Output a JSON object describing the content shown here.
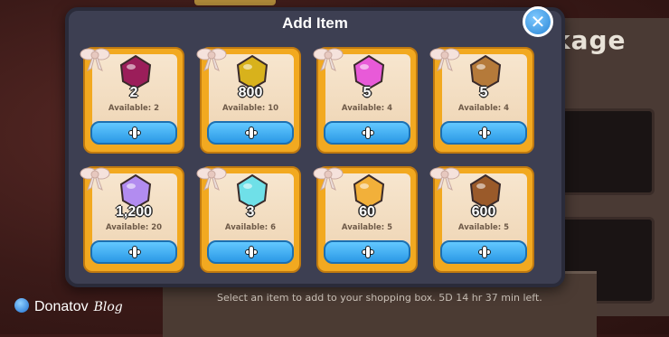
{
  "background": {
    "partial_title": "kage",
    "info_text": "Select an item to add to your shopping box. 5D 14 hr 37 min left."
  },
  "modal": {
    "title": "Add Item",
    "close_label": "✕"
  },
  "items": [
    {
      "qty": "2",
      "available": "Available: 2",
      "icon": "dark-crystal-icon",
      "color": "#9b1e5a"
    },
    {
      "qty": "800",
      "available": "Available: 10",
      "icon": "gold-clock-icon",
      "color": "#d8b21c"
    },
    {
      "qty": "5",
      "available": "Available: 4",
      "icon": "pink-cookie-cutter-icon",
      "color": "#e85ad8"
    },
    {
      "qty": "5",
      "available": "Available: 4",
      "icon": "bronze-medallion-icon",
      "color": "#b57a3a"
    },
    {
      "qty": "1,200",
      "available": "Available: 20",
      "icon": "rainbow-cube-icon",
      "color": "#b28cf0"
    },
    {
      "qty": "3",
      "available": "Available: 6",
      "icon": "prism-crystal-icon",
      "color": "#6fe0e8"
    },
    {
      "qty": "60",
      "available": "Available: 5",
      "icon": "heart-dough-icon",
      "color": "#f2b03a"
    },
    {
      "qty": "600",
      "available": "Available: 5",
      "icon": "choco-dough-icon",
      "color": "#9a5a2a"
    }
  ],
  "watermark": {
    "brand": "Donatov",
    "suffix": "Blog"
  }
}
